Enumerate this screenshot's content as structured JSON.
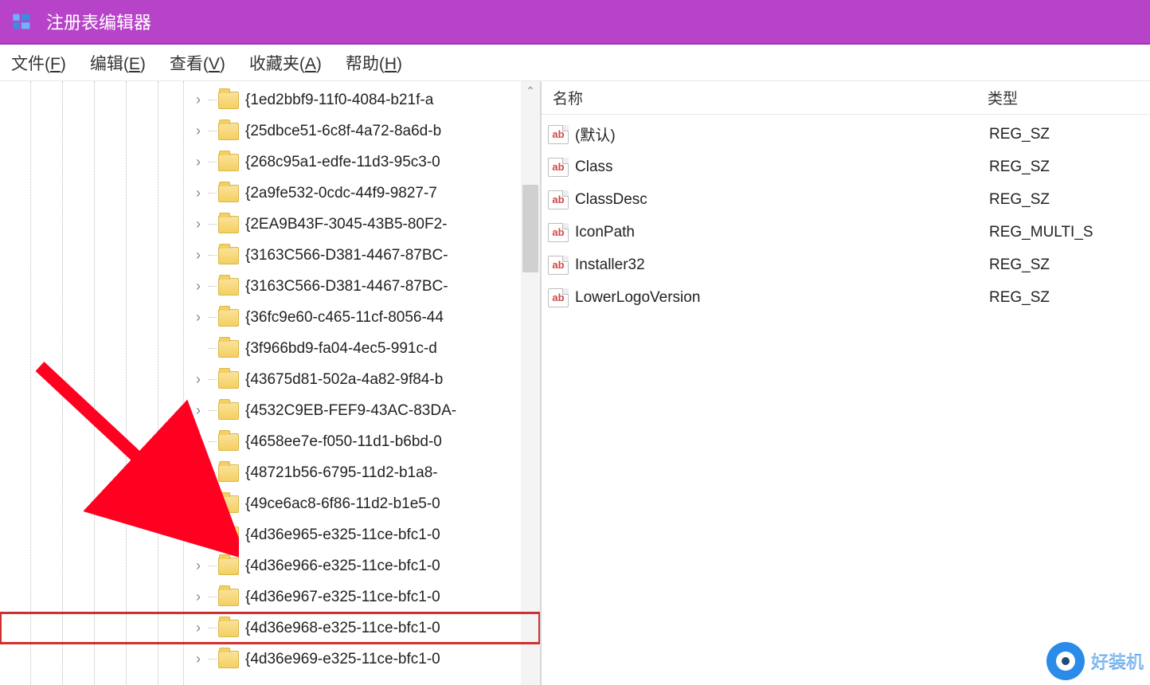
{
  "window": {
    "title": "注册表编辑器"
  },
  "menu": {
    "file": {
      "label": "文件(",
      "accel": "F",
      "tail": ")"
    },
    "edit": {
      "label": "编辑(",
      "accel": "E",
      "tail": ")"
    },
    "view": {
      "label": "查看(",
      "accel": "V",
      "tail": ")"
    },
    "fav": {
      "label": "收藏夹(",
      "accel": "A",
      "tail": ")"
    },
    "help": {
      "label": "帮助(",
      "accel": "H",
      "tail": ")"
    }
  },
  "tree": {
    "items": [
      {
        "label": "{1ed2bbf9-11f0-4084-b21f-a",
        "expandable": true,
        "highlighted": false
      },
      {
        "label": "{25dbce51-6c8f-4a72-8a6d-b",
        "expandable": true,
        "highlighted": false
      },
      {
        "label": "{268c95a1-edfe-11d3-95c3-0",
        "expandable": true,
        "highlighted": false
      },
      {
        "label": "{2a9fe532-0cdc-44f9-9827-7",
        "expandable": true,
        "highlighted": false
      },
      {
        "label": "{2EA9B43F-3045-43B5-80F2-",
        "expandable": true,
        "highlighted": false
      },
      {
        "label": "{3163C566-D381-4467-87BC-",
        "expandable": true,
        "highlighted": false
      },
      {
        "label": "{3163C566-D381-4467-87BC-",
        "expandable": true,
        "highlighted": false
      },
      {
        "label": "{36fc9e60-c465-11cf-8056-44",
        "expandable": true,
        "highlighted": false
      },
      {
        "label": "{3f966bd9-fa04-4ec5-991c-d",
        "expandable": false,
        "highlighted": false
      },
      {
        "label": "{43675d81-502a-4a82-9f84-b",
        "expandable": true,
        "highlighted": false
      },
      {
        "label": "{4532C9EB-FEF9-43AC-83DA-",
        "expandable": true,
        "highlighted": false
      },
      {
        "label": "{4658ee7e-f050-11d1-b6bd-0",
        "expandable": true,
        "highlighted": false
      },
      {
        "label": "{48721b56-6795-11d2-b1a8-",
        "expandable": true,
        "highlighted": false
      },
      {
        "label": "{49ce6ac8-6f86-11d2-b1e5-0",
        "expandable": true,
        "highlighted": false
      },
      {
        "label": "{4d36e965-e325-11ce-bfc1-0",
        "expandable": true,
        "highlighted": false
      },
      {
        "label": "{4d36e966-e325-11ce-bfc1-0",
        "expandable": true,
        "highlighted": false
      },
      {
        "label": "{4d36e967-e325-11ce-bfc1-0",
        "expandable": true,
        "highlighted": false
      },
      {
        "label": "{4d36e968-e325-11ce-bfc1-0",
        "expandable": true,
        "highlighted": true
      },
      {
        "label": "{4d36e969-e325-11ce-bfc1-0",
        "expandable": true,
        "highlighted": false
      }
    ]
  },
  "list": {
    "headers": {
      "name": "名称",
      "type": "类型"
    },
    "rows": [
      {
        "name": "(默认)",
        "type": "REG_SZ",
        "icon": "ab"
      },
      {
        "name": "Class",
        "type": "REG_SZ",
        "icon": "ab"
      },
      {
        "name": "ClassDesc",
        "type": "REG_SZ",
        "icon": "ab"
      },
      {
        "name": "IconPath",
        "type": "REG_MULTI_S",
        "icon": "ab"
      },
      {
        "name": "Installer32",
        "type": "REG_SZ",
        "icon": "ab"
      },
      {
        "name": "LowerLogoVersion",
        "type": "REG_SZ",
        "icon": "ab"
      }
    ]
  },
  "watermark": {
    "text": "好装机"
  }
}
